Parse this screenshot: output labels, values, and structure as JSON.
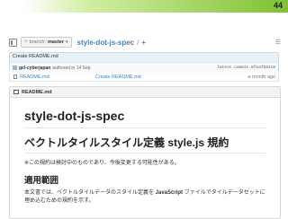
{
  "slide": {
    "number": "44"
  },
  "repo": {
    "branch_prefix": "branch:",
    "branch_name": "master",
    "path": "style-dot-js-spec",
    "separator": "/",
    "add_label": "+"
  },
  "commit": {
    "title": "Create README.md",
    "author": "gel-cyberjapan",
    "authored_text": "authored in 14 Sep",
    "latest_text": "latest commit 8fea7b61c8"
  },
  "files": [
    {
      "name": "README.md",
      "message": "Create README.md",
      "age": "a month ago"
    }
  ],
  "readme": {
    "header_label": "README.md",
    "title": "style-dot-js-spec",
    "subtitle": "ベクトルタイルスタイル定義 style.js 規約",
    "note": "※この規約は検討中のものであり、今後変更する可能性がある。",
    "section_title": "適用範囲",
    "para_before": "本文書では、ベクトルタイルデータのスタイル定義を ",
    "para_bold": "JavaScript",
    "para_after": " ファイルでタイルデータセットに埋め込むための規約を示す。"
  },
  "colors": {
    "accent_green": "#7dc22f",
    "link_blue": "#4183c4"
  }
}
